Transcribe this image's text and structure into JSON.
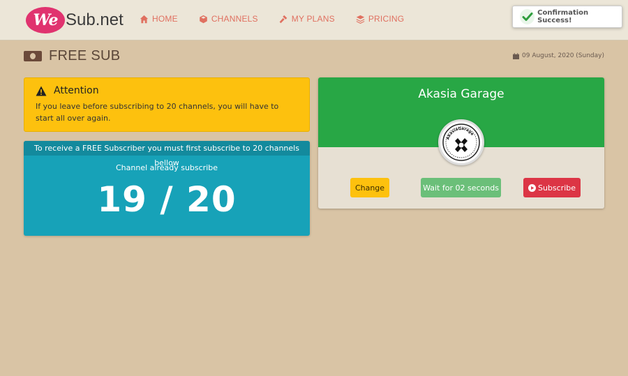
{
  "brand": {
    "badge": "We",
    "name": "Sub.net"
  },
  "nav": {
    "home": "HOME",
    "channels": "CHANNELS",
    "my_plans": "MY PLANS",
    "pricing": "PRICING"
  },
  "toast": {
    "message": "Confirmation Success!"
  },
  "page": {
    "title": "FREE SUB",
    "date": "09 August, 2020 (Sunday)"
  },
  "alert": {
    "title": "Attention",
    "body": "If you leave before subscribing to 20 channels, you will have to start all over again."
  },
  "counter": {
    "header": "To receive a FREE Subscriber you must first subscribe to 20 channels bellow",
    "subtitle": "Channel already subscribe",
    "value": "19 / 20"
  },
  "channel": {
    "name": "Akasia Garage",
    "avatar_text": "AkasiaGarage",
    "change_label": "Change",
    "wait_label": "Wait for 02 seconds",
    "subscribe_label": "Subscribe"
  },
  "colors": {
    "nav_link": "#e07060",
    "alert": "#fdc10e",
    "counter": "#17a2b8",
    "channel_header": "#28a745",
    "subscribe": "#dc3545",
    "background": "#d9c4a5"
  }
}
